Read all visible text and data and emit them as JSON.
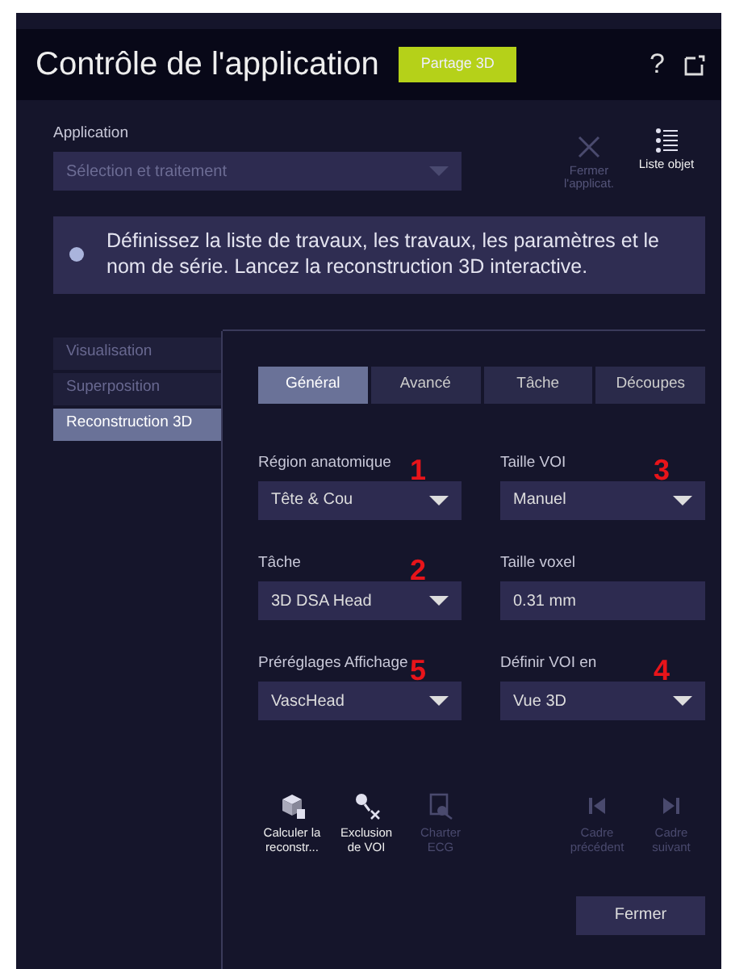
{
  "window": {
    "title": "Contrôle de l'application",
    "badge": "Partage 3D",
    "help": "?"
  },
  "application": {
    "label": "Application",
    "value": "Sélection et traitement",
    "disabled": true
  },
  "header_actions": [
    {
      "label": "Fermer l'applicat.",
      "disabled": true
    },
    {
      "label": "Liste objet",
      "disabled": false
    }
  ],
  "info": "Définissez la liste de travaux, les travaux, les paramètres et le nom de série. Lancez la reconstruction 3D interactive.",
  "sidebar": [
    {
      "label": "Visualisation",
      "selected": false,
      "disabled": true
    },
    {
      "label": "Superposition",
      "selected": false,
      "disabled": true
    },
    {
      "label": "Reconstruction 3D",
      "selected": true,
      "disabled": false
    }
  ],
  "tabs": [
    {
      "label": "Général",
      "selected": true
    },
    {
      "label": "Avancé",
      "selected": false
    },
    {
      "label": "Tâche",
      "selected": false
    },
    {
      "label": "Découpes",
      "selected": false
    }
  ],
  "fields": [
    {
      "label": "Région anatomique",
      "value": "Tête & Cou",
      "kind": "dropdown",
      "marker": "1"
    },
    {
      "label": "Taille VOI",
      "value": "Manuel",
      "kind": "dropdown",
      "marker": "3"
    },
    {
      "label": "Tâche",
      "value": "3D DSA Head",
      "kind": "dropdown",
      "marker": "2"
    },
    {
      "label": "Taille voxel",
      "value": "0.31 mm",
      "kind": "text"
    },
    {
      "label": "Préréglages Affichage",
      "value": "VascHead",
      "kind": "dropdown",
      "marker": "5"
    },
    {
      "label": "Définir VOI en",
      "value": "Vue 3D",
      "kind": "dropdown",
      "marker": "4"
    }
  ],
  "tools": [
    {
      "label": "Calculer la reconstr...",
      "disabled": false
    },
    {
      "label": "Exclusion de VOI",
      "disabled": false
    },
    {
      "label": "Charter ECG",
      "disabled": true
    },
    {
      "label": "Cadre précédent",
      "disabled": true
    },
    {
      "label": "Cadre suivant",
      "disabled": true
    }
  ],
  "close_button": "Fermer"
}
